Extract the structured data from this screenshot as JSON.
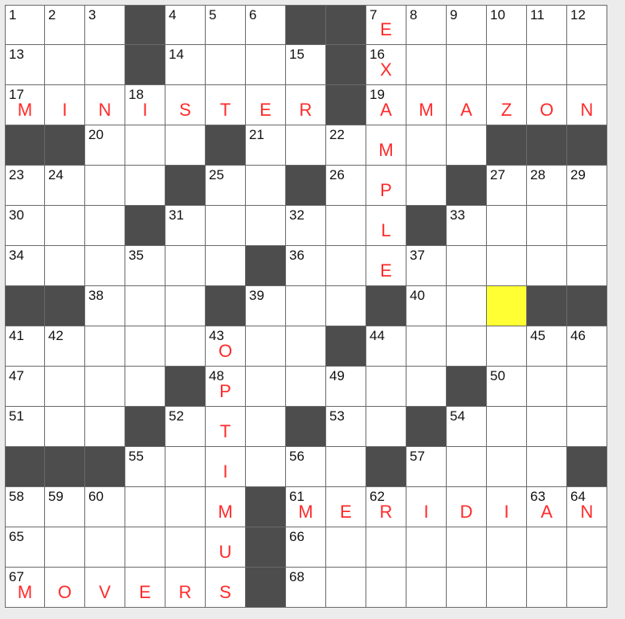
{
  "colors": {
    "black": "#4d4d4d",
    "highlight": "#ffff33",
    "entry": "#ff2a2a"
  },
  "grid": {
    "size": 15,
    "blocks": [
      [
        0,
        3
      ],
      [
        0,
        7
      ],
      [
        0,
        8
      ],
      [
        1,
        3
      ],
      [
        1,
        8
      ],
      [
        2,
        8
      ],
      [
        3,
        0
      ],
      [
        3,
        1
      ],
      [
        3,
        5
      ],
      [
        3,
        12
      ],
      [
        3,
        13
      ],
      [
        3,
        14
      ],
      [
        4,
        4
      ],
      [
        4,
        7
      ],
      [
        4,
        11
      ],
      [
        5,
        3
      ],
      [
        5,
        10
      ],
      [
        6,
        6
      ],
      [
        7,
        0
      ],
      [
        7,
        1
      ],
      [
        7,
        5
      ],
      [
        7,
        9
      ],
      [
        7,
        13
      ],
      [
        7,
        14
      ],
      [
        8,
        8
      ],
      [
        9,
        4
      ],
      [
        9,
        11
      ],
      [
        10,
        3
      ],
      [
        10,
        7
      ],
      [
        10,
        10
      ],
      [
        11,
        0
      ],
      [
        11,
        1
      ],
      [
        11,
        2
      ],
      [
        11,
        9
      ],
      [
        11,
        14
      ],
      [
        12,
        6
      ],
      [
        13,
        6
      ],
      [
        14,
        6
      ]
    ],
    "highlight": [
      [
        7,
        12
      ]
    ],
    "numbers": [
      [
        0,
        0,
        "1"
      ],
      [
        0,
        1,
        "2"
      ],
      [
        0,
        2,
        "3"
      ],
      [
        0,
        4,
        "4"
      ],
      [
        0,
        5,
        "5"
      ],
      [
        0,
        6,
        "6"
      ],
      [
        0,
        9,
        "7"
      ],
      [
        0,
        10,
        "8"
      ],
      [
        0,
        11,
        "9"
      ],
      [
        0,
        12,
        "10"
      ],
      [
        0,
        13,
        "11"
      ],
      [
        0,
        14,
        "12"
      ],
      [
        1,
        0,
        "13"
      ],
      [
        1,
        4,
        "14"
      ],
      [
        1,
        7,
        "15"
      ],
      [
        1,
        9,
        "16"
      ],
      [
        2,
        0,
        "17"
      ],
      [
        2,
        3,
        "18"
      ],
      [
        2,
        9,
        "19"
      ],
      [
        3,
        2,
        "20"
      ],
      [
        3,
        6,
        "21"
      ],
      [
        3,
        8,
        "22"
      ],
      [
        4,
        0,
        "23"
      ],
      [
        4,
        1,
        "24"
      ],
      [
        4,
        5,
        "25"
      ],
      [
        4,
        8,
        "26"
      ],
      [
        4,
        12,
        "27"
      ],
      [
        4,
        13,
        "28"
      ],
      [
        4,
        14,
        "29"
      ],
      [
        5,
        0,
        "30"
      ],
      [
        5,
        4,
        "31"
      ],
      [
        5,
        7,
        "32"
      ],
      [
        5,
        11,
        "33"
      ],
      [
        6,
        0,
        "34"
      ],
      [
        6,
        3,
        "35"
      ],
      [
        6,
        7,
        "36"
      ],
      [
        6,
        10,
        "37"
      ],
      [
        7,
        2,
        "38"
      ],
      [
        7,
        6,
        "39"
      ],
      [
        7,
        10,
        "40"
      ],
      [
        8,
        0,
        "41"
      ],
      [
        8,
        1,
        "42"
      ],
      [
        8,
        5,
        "43"
      ],
      [
        8,
        9,
        "44"
      ],
      [
        8,
        13,
        "45"
      ],
      [
        8,
        14,
        "46"
      ],
      [
        9,
        0,
        "47"
      ],
      [
        9,
        5,
        "48"
      ],
      [
        9,
        8,
        "49"
      ],
      [
        9,
        12,
        "50"
      ],
      [
        10,
        0,
        "51"
      ],
      [
        10,
        4,
        "52"
      ],
      [
        10,
        8,
        "53"
      ],
      [
        10,
        11,
        "54"
      ],
      [
        11,
        3,
        "55"
      ],
      [
        11,
        7,
        "56"
      ],
      [
        11,
        10,
        "57"
      ],
      [
        12,
        0,
        "58"
      ],
      [
        12,
        1,
        "59"
      ],
      [
        12,
        2,
        "60"
      ],
      [
        12,
        7,
        "61"
      ],
      [
        12,
        9,
        "62"
      ],
      [
        12,
        13,
        "63"
      ],
      [
        12,
        14,
        "64"
      ],
      [
        13,
        0,
        "65"
      ],
      [
        13,
        7,
        "66"
      ],
      [
        14,
        0,
        "67"
      ],
      [
        14,
        7,
        "68"
      ]
    ],
    "letters": [
      [
        0,
        9,
        "E"
      ],
      [
        1,
        9,
        "X"
      ],
      [
        2,
        9,
        "A"
      ],
      [
        3,
        9,
        "M"
      ],
      [
        4,
        9,
        "P"
      ],
      [
        5,
        9,
        "L"
      ],
      [
        6,
        9,
        "E"
      ],
      [
        2,
        0,
        "M"
      ],
      [
        2,
        1,
        "I"
      ],
      [
        2,
        2,
        "N"
      ],
      [
        2,
        3,
        "I"
      ],
      [
        2,
        4,
        "S"
      ],
      [
        2,
        5,
        "T"
      ],
      [
        2,
        6,
        "E"
      ],
      [
        2,
        7,
        "R"
      ],
      [
        2,
        10,
        "M"
      ],
      [
        2,
        11,
        "A"
      ],
      [
        2,
        12,
        "Z"
      ],
      [
        2,
        13,
        "O"
      ],
      [
        2,
        14,
        "N"
      ],
      [
        8,
        5,
        "O"
      ],
      [
        9,
        5,
        "P"
      ],
      [
        10,
        5,
        "T"
      ],
      [
        11,
        5,
        "I"
      ],
      [
        12,
        5,
        "M"
      ],
      [
        13,
        5,
        "U"
      ],
      [
        14,
        5,
        "S"
      ],
      [
        12,
        7,
        "M"
      ],
      [
        12,
        8,
        "E"
      ],
      [
        12,
        9,
        "R"
      ],
      [
        12,
        10,
        "I"
      ],
      [
        12,
        11,
        "D"
      ],
      [
        12,
        12,
        "I"
      ],
      [
        12,
        13,
        "A"
      ],
      [
        12,
        14,
        "N"
      ],
      [
        14,
        0,
        "M"
      ],
      [
        14,
        1,
        "O"
      ],
      [
        14,
        2,
        "V"
      ],
      [
        14,
        3,
        "E"
      ],
      [
        14,
        4,
        "R"
      ]
    ]
  }
}
